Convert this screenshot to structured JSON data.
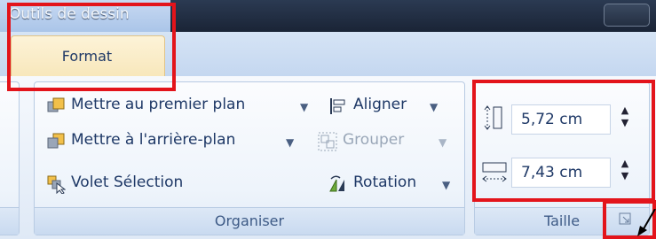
{
  "window": {
    "contextual_tool_label": "Outils de dessin"
  },
  "tabs": {
    "active_label": "Format"
  },
  "organiser": {
    "group_label": "Organiser",
    "bring_forward": "Mettre au premier plan",
    "send_backward": "Mettre à l'arrière-plan",
    "selection_pane": "Volet Sélection",
    "align": "Aligner",
    "group": "Grouper",
    "rotate": "Rotation"
  },
  "taille": {
    "group_label": "Taille",
    "height_value": "5,72 cm",
    "width_value": "7,43 cm"
  },
  "highlight_color": "#e3141b"
}
